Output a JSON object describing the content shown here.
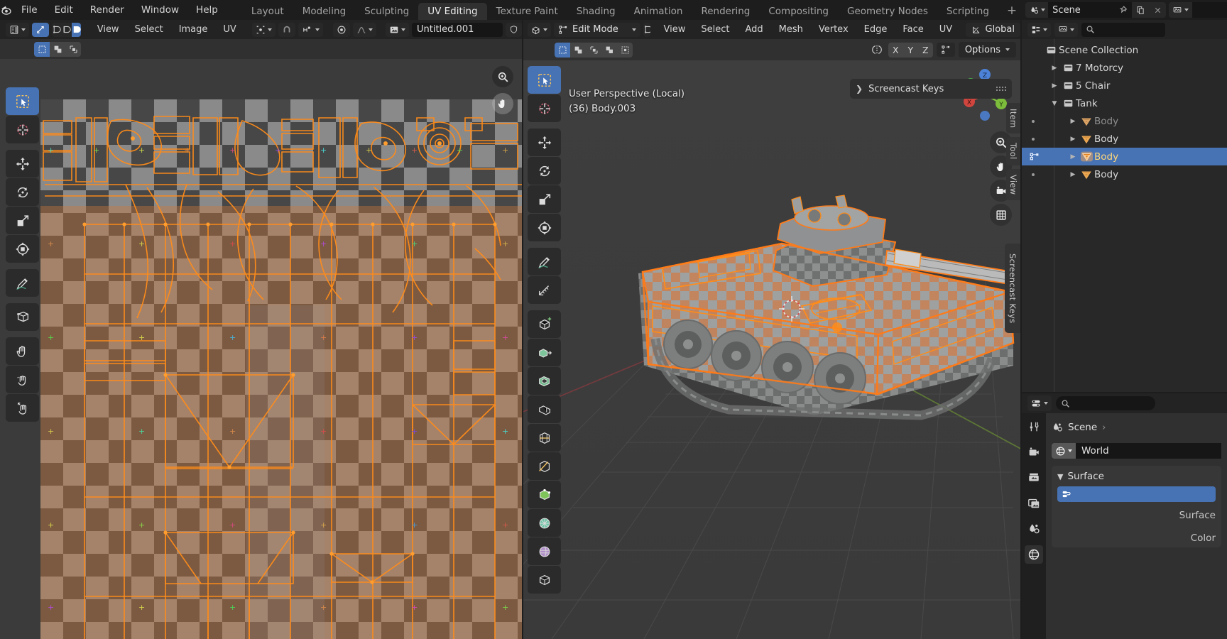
{
  "app": {
    "title": "Blender",
    "logo_icon": "blender-logo-icon"
  },
  "topbar": {
    "menus": [
      "File",
      "Edit",
      "Render",
      "Window",
      "Help"
    ],
    "workspace_tabs": [
      {
        "label": "Layout",
        "active": false
      },
      {
        "label": "Modeling",
        "active": false
      },
      {
        "label": "Sculpting",
        "active": false
      },
      {
        "label": "UV Editing",
        "active": true
      },
      {
        "label": "Texture Paint",
        "active": false
      },
      {
        "label": "Shading",
        "active": false
      },
      {
        "label": "Animation",
        "active": false
      },
      {
        "label": "Rendering",
        "active": false
      },
      {
        "label": "Compositing",
        "active": false
      },
      {
        "label": "Geometry Nodes",
        "active": false
      },
      {
        "label": "Scripting",
        "active": false
      }
    ],
    "add_workspace_label": "+",
    "scene": {
      "icon": "scene-icon",
      "name": "Scene",
      "pin_icon": "pin-icon",
      "duplicate_icon": "copy-icon",
      "unlink_icon": "x-icon"
    },
    "view_layer": {
      "icon": "view-layer-icon",
      "name": ""
    }
  },
  "uv_editor": {
    "header": {
      "editor_type_icon": "uv-editor-icon",
      "mode_icon": "uv-sync-icon",
      "select_modes": [
        "vertex-select-icon",
        "edge-select-icon",
        "face-select-icon"
      ],
      "menus": [
        "View",
        "Select",
        "Image",
        "UV"
      ],
      "pivot_icon": "pivot-icon",
      "snap_icon": "snap-magnet-icon",
      "snap_target_icon": "snap-increment-icon",
      "proportional_icon": "proportional-editing-icon",
      "falloff_icon": "falloff-smooth-icon",
      "image_browse_icon": "image-browse-icon",
      "image_name": "Untitled.001",
      "fake_user_icon": "shield-icon"
    },
    "subheader": {
      "select_tools": [
        "tweak",
        "box",
        "circle",
        "lasso"
      ]
    },
    "toolbar": [
      {
        "name": "tweak-tool",
        "active": true
      },
      {
        "name": "cursor-tool",
        "active": false
      },
      {
        "name": "move-tool",
        "active": false
      },
      {
        "name": "rotate-tool",
        "active": false
      },
      {
        "name": "scale-tool",
        "active": false
      },
      {
        "name": "transform-tool",
        "active": false
      },
      {
        "name": "annotate-tool",
        "active": false
      },
      {
        "name": "rip-region-tool",
        "active": false
      },
      {
        "name": "grab-tool",
        "active": false
      },
      {
        "name": "relax-tool",
        "active": false
      },
      {
        "name": "pinch-tool",
        "active": false
      }
    ],
    "overlays": {
      "zoom_icon": "zoom-in-icon",
      "pan_icon": "pan-hand-icon"
    }
  },
  "viewport_3d": {
    "header": {
      "editor_type_icon": "3d-viewport-icon",
      "mode_icon": "edit-mode-icon",
      "mode_label": "Edit Mode",
      "select_modes": [
        "vertex-select-icon",
        "edge-select-icon",
        "face-select-icon"
      ],
      "menus": [
        "View",
        "Select",
        "Add",
        "Mesh",
        "Vertex",
        "Edge",
        "Face",
        "UV"
      ],
      "orientation_icon": "orientation-gizmo-icon",
      "orientation_label": "Global"
    },
    "subheader": {
      "select_tools": [
        "tweak",
        "box",
        "circle",
        "lasso",
        "select-all"
      ],
      "mirror_icon": "mirror-icon",
      "axis_buttons": [
        "X",
        "Y",
        "Z"
      ],
      "uv_mirror_icon": "uv-mirror-icon",
      "options_label": "Options"
    },
    "overlay_text": {
      "view_name": "User Perspective (Local)",
      "object_info": "(36) Body.003"
    },
    "gizmo": {
      "axes": [
        "X",
        "Y",
        "Z"
      ]
    },
    "nav_icons": [
      "zoom-in-icon",
      "pan-hand-icon",
      "camera-icon",
      "ortho-persp-icon"
    ],
    "screencast_keys": {
      "expand_icon": "chevron-right-icon",
      "checkbox": "checkbox-unchecked",
      "label": "Screencast Keys",
      "grip_icon": "drag-grip-icon"
    },
    "side_tabs": [
      "Item",
      "Tool",
      "View"
    ],
    "right_tab": "Screencast Keys",
    "toolbar": [
      {
        "name": "tweak-tool",
        "active": true
      },
      {
        "name": "cursor-tool",
        "active": false
      },
      {
        "name": "move-tool",
        "active": false
      },
      {
        "name": "rotate-tool",
        "active": false
      },
      {
        "name": "scale-tool",
        "active": false
      },
      {
        "name": "transform-tool",
        "active": false
      },
      {
        "name": "annotate-tool",
        "active": false
      },
      {
        "name": "measure-tool",
        "active": false
      },
      {
        "name": "add-cube-tool",
        "active": false
      },
      {
        "name": "extrude-region-tool",
        "active": false
      },
      {
        "name": "inset-faces-tool",
        "active": false
      },
      {
        "name": "bevel-tool",
        "active": false
      },
      {
        "name": "loop-cut-tool",
        "active": false
      },
      {
        "name": "knife-tool",
        "active": false
      },
      {
        "name": "poly-build-tool",
        "active": false
      },
      {
        "name": "spin-tool",
        "active": false
      },
      {
        "name": "smooth-tool",
        "active": false
      },
      {
        "name": "shrink-fatten-tool",
        "active": false
      }
    ]
  },
  "outliner": {
    "header": {
      "editor_type_icon": "outliner-icon",
      "display_mode_icon": "view-layer-icon",
      "filter_icon": "filter-icon",
      "search_placeholder": ""
    },
    "rows": [
      {
        "label": "Scene Collection",
        "icon": "collection-icon",
        "indent": 0,
        "disclosure": "",
        "selected": false,
        "dim": false
      },
      {
        "label": "7 Motorcy",
        "icon": "collection-icon",
        "indent": 1,
        "disclosure": "closed",
        "selected": false,
        "dim": false
      },
      {
        "label": "5 Chair",
        "icon": "collection-icon",
        "indent": 1,
        "disclosure": "closed",
        "selected": false,
        "dim": false
      },
      {
        "label": "Tank",
        "icon": "collection-icon",
        "indent": 1,
        "disclosure": "open",
        "selected": false,
        "dim": false
      },
      {
        "label": "Body",
        "icon": "mesh-object-icon",
        "indent": 2,
        "disclosure": "closed",
        "selected": false,
        "dim": true
      },
      {
        "label": "Body",
        "icon": "mesh-object-icon",
        "indent": 2,
        "disclosure": "closed",
        "selected": false,
        "dim": false
      },
      {
        "label": "Body",
        "icon": "mesh-object-icon",
        "indent": 2,
        "disclosure": "closed",
        "selected": true,
        "dim": false
      },
      {
        "label": "Body",
        "icon": "mesh-object-icon",
        "indent": 2,
        "disclosure": "closed",
        "selected": false,
        "dim": false
      }
    ]
  },
  "properties": {
    "header": {
      "editor_type_icon": "properties-icon",
      "search_placeholder": ""
    },
    "tabs": [
      {
        "name": "tool-tab",
        "icon": "tool-icon",
        "active": false
      },
      {
        "name": "render-tab",
        "icon": "render-camera-icon",
        "active": false
      },
      {
        "name": "output-tab",
        "icon": "printer-icon",
        "active": false
      },
      {
        "name": "view-layer-tab",
        "icon": "images-icon",
        "active": false
      },
      {
        "name": "scene-tab",
        "icon": "scene-icon",
        "active": false
      },
      {
        "name": "world-tab",
        "icon": "world-globe-icon",
        "active": true
      }
    ],
    "breadcrumb": {
      "icon": "scene-icon",
      "label": "Scene"
    },
    "world_field": {
      "icon": "world-globe-icon",
      "name": "World"
    },
    "surface_panel": {
      "title": "Surface",
      "shader_row_icon": "node-icon",
      "shader_value": "",
      "rows": [
        {
          "label": "Surface"
        },
        {
          "label": "Color"
        }
      ]
    }
  },
  "colors": {
    "accent_blue": "#4772b3",
    "orange_select": "#ff9d2e",
    "header_bg": "#232323",
    "area_bg": "#303030",
    "outliner_bg": "#282828",
    "viewport_bg": "#3d3d3d",
    "text": "#e0e0e0"
  }
}
